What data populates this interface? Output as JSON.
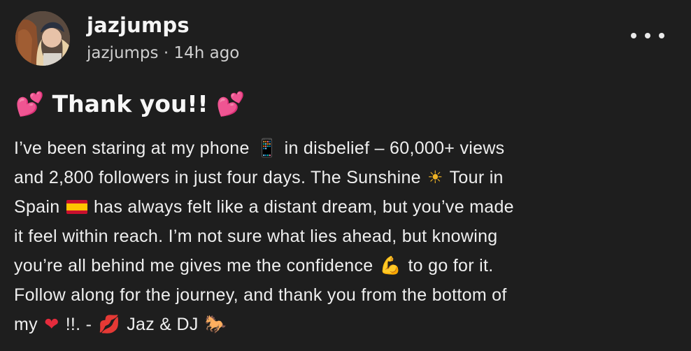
{
  "post": {
    "author": {
      "display_name": "jazjumps",
      "handle": "jazjumps",
      "separator": "·",
      "time_ago": "14h ago"
    },
    "title": {
      "emoji_left": "💕",
      "text": "Thank you!!",
      "emoji_right": "💕"
    },
    "body_lines": [
      [
        "I’ve been staring at my phone ",
        "📱",
        " in disbelief – 60,000+ views"
      ],
      [
        "and 2,800 followers in just four days. The Sunshine ",
        "☀",
        " Tour in"
      ],
      [
        "Spain ",
        "flag-spain",
        " has always felt like a distant dream, but you’ve made"
      ],
      [
        "it feel within reach. I’m not sure what lies ahead, but knowing"
      ],
      [
        "you’re all behind me gives me the confidence ",
        "💪",
        " to go for it."
      ],
      [
        "Follow along for the journey, and thank you from the bottom of"
      ],
      [
        "my ",
        "❤",
        " !!. - ",
        "💋",
        " Jaz & DJ ",
        "🐎"
      ]
    ],
    "body": {
      "l1a": "I’ve been staring at my phone",
      "l1b": "in disbelief – 60,000+ views",
      "l2a": "and 2,800 followers in just four days. The Sunshine",
      "l2b": "Tour in",
      "l3a": "Spain",
      "l3b": "has always felt like a distant dream, but you’ve made",
      "l4": "it feel within reach. I’m not sure what lies ahead, but knowing",
      "l5a": "you’re all behind me gives me the confidence",
      "l5b": "to go for it.",
      "l6": "Follow along for the journey, and thank you from the bottom of",
      "l7a": "my",
      "l7b": "!!. -",
      "l7c": "Jaz & DJ"
    },
    "emojis": {
      "phone": "📱",
      "sun": "☀",
      "muscle": "💪",
      "heart": "❤",
      "kiss": "💋",
      "horse": "🐎"
    },
    "icons": {
      "more": "more-options-icon",
      "avatar": "user-avatar"
    },
    "colors": {
      "background": "#1e1e1e",
      "text": "#efefef",
      "muted": "#cfcfcf"
    }
  }
}
